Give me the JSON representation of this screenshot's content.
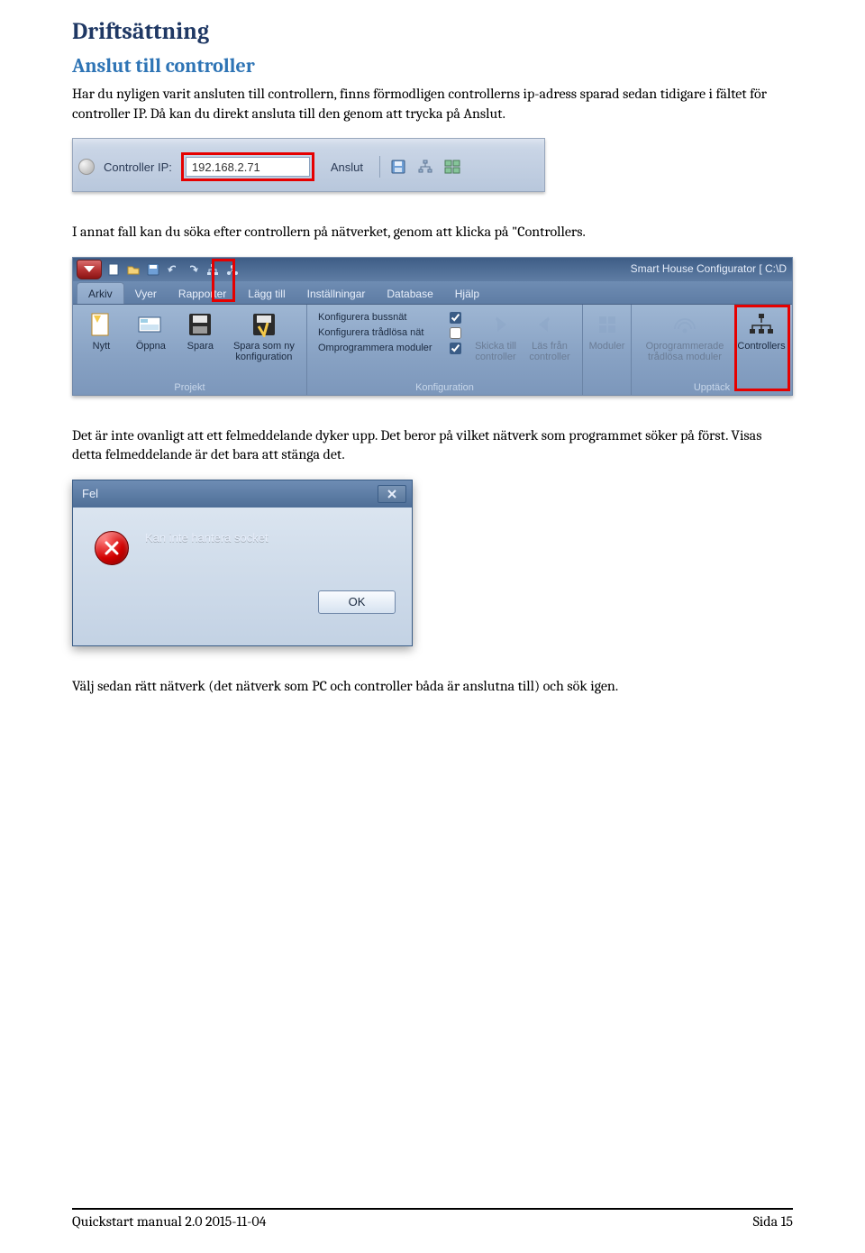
{
  "headings": {
    "h1": "Driftsättning",
    "h2": "Anslut till controller"
  },
  "paragraphs": {
    "p1": "Har du nyligen varit ansluten till controllern, finns förmodligen controllerns ip-adress sparad sedan tidigare i fältet för controller IP. Då kan du direkt ansluta till den genom att trycka på Anslut.",
    "p2": "I annat fall kan du söka efter controllern på nätverket, genom att klicka på \"Controllers.",
    "p3": "Det är inte ovanligt att ett felmeddelande dyker upp. Det beror på vilket nätverk som programmet söker på först. Visas detta felmeddelande är det bara att stänga det.",
    "p4": "Välj sedan rätt nätverk (det nätverk som PC och controller båda är anslutna till) och sök igen."
  },
  "fig1": {
    "ip_label": "Controller IP:",
    "ip_value": "192.168.2.71",
    "connect_label": "Anslut"
  },
  "fig2": {
    "qat_title": "Smart House Configurator [ C:\\D",
    "tabs": [
      "Arkiv",
      "Vyer",
      "Rapporter",
      "Lägg till",
      "Inställningar",
      "Database",
      "Hjälp"
    ],
    "group_project": {
      "title": "Projekt",
      "buttons": {
        "new": "Nytt",
        "open": "Öppna",
        "save": "Spara",
        "save_as": "Spara som ny konfiguration"
      }
    },
    "group_config": {
      "title": "Konfiguration",
      "options": {
        "bus": "Konfigurera bussnät",
        "wireless": "Konfigurera trådlösa nät",
        "reprogram": "Omprogrammera moduler"
      },
      "buttons": {
        "send": "Skicka till controller",
        "read": "Läs från controller"
      }
    },
    "group_modules": {
      "btn": "Moduler"
    },
    "group_discover": {
      "title": "Upptäck",
      "buttons": {
        "unprog": "Oprogrammerade trådlösa moduler",
        "controllers": "Controllers"
      }
    }
  },
  "fig3": {
    "title": "Fel",
    "message": "Kan inte hantera socket",
    "ok": "OK"
  },
  "footer": {
    "left": "Quickstart manual 2.0 2015-11-04",
    "right": "Sida 15"
  }
}
